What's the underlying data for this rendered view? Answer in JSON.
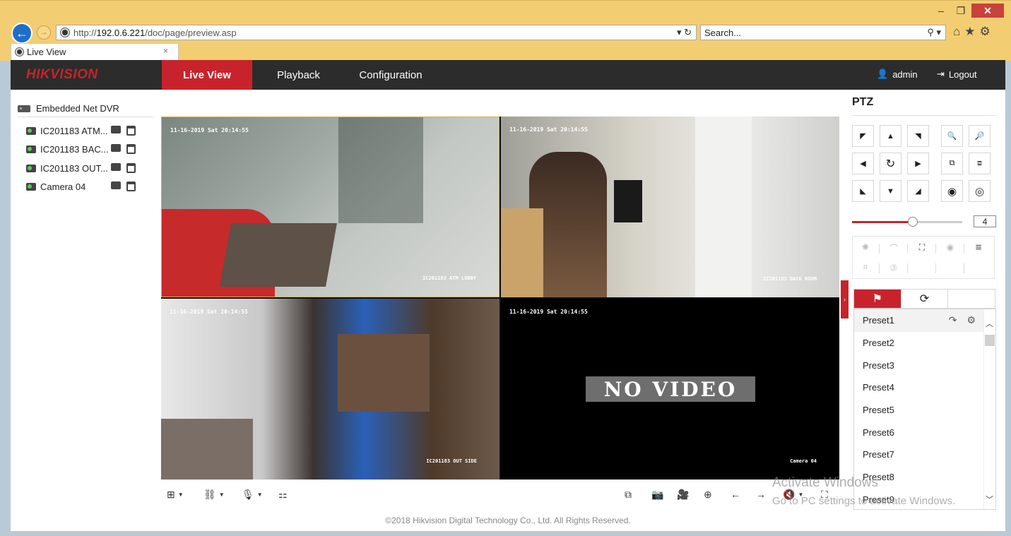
{
  "browser": {
    "url_prefix": "http://",
    "url_host": "192.0.6.221",
    "url_path": "/doc/page/preview.asp",
    "url_controls": "▾ ↻",
    "search_placeholder": "Search...",
    "search_controls": "⚲ ▾",
    "tab_title": "Live View",
    "tab_close": "×",
    "window_buttons": [
      "–",
      "❐",
      "✕"
    ],
    "tool_icons": [
      "⌂",
      "★",
      "⚙"
    ]
  },
  "app": {
    "logo": "HIKVISION",
    "nav": {
      "live": "Live View",
      "playback": "Playback",
      "configuration": "Configuration"
    },
    "user": "admin",
    "logout": "Logout"
  },
  "tree": {
    "root": "Embedded Net DVR",
    "cameras": [
      {
        "name": "IC201183 ATM..."
      },
      {
        "name": "IC201183 BAC..."
      },
      {
        "name": "IC201183 OUT..."
      },
      {
        "name": "Camera 04"
      }
    ]
  },
  "video": {
    "tiles": [
      {
        "timestamp": "11-16-2019 Sat 20:14:55",
        "label": "IC201183 ATM LOBBY"
      },
      {
        "timestamp": "11-16-2019 Sat 20:14:55",
        "label": "IC201183 BACK ROOM"
      },
      {
        "timestamp": "11-16-2019 Sat 20:14:55",
        "label": "IC201183 OUT SIDE"
      },
      {
        "timestamp": "11-16-2019 Sat 20:14:55",
        "label": "Camera 04",
        "overlay": "NO VIDEO"
      }
    ]
  },
  "footer": "©2018 Hikvision Digital Technology Co., Ltd. All Rights Reserved.",
  "ptz": {
    "title": "PTZ",
    "speed": "4",
    "speed_fraction": 0.55,
    "presets": [
      "Preset1",
      "Preset2",
      "Preset3",
      "Preset4",
      "Preset5",
      "Preset6",
      "Preset7",
      "Preset8",
      "Preset9"
    ]
  },
  "watermark": {
    "line1": "Activate Windows",
    "line2": "Go to PC settings to activate Windows."
  },
  "colors": {
    "brand_red": "#c8232c",
    "nav_dark": "#2c2c2c",
    "ie_chrome": "#f3cd72"
  }
}
